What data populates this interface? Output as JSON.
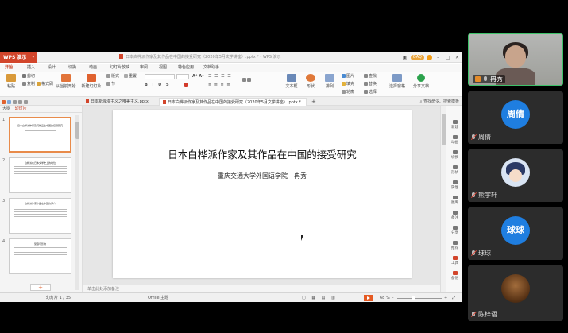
{
  "wps": {
    "app_label": "WPS 演示",
    "window_title": "日本白桦派作家及其作品在中国的接受研究（2020年5月文学讲座）.pptx * - WPS 演示",
    "user_label": "QAQ",
    "menus": [
      "开始",
      "插入",
      "设计",
      "切换",
      "动画",
      "幻灯片放映",
      "审阅",
      "视图",
      "特色应用",
      "文档助手"
    ],
    "ribbon": {
      "paste": "粘贴",
      "cut": "剪切",
      "copy": "复制",
      "format_painter": "格式刷",
      "from_start": "从当前开始",
      "new_slide": "新建幻灯片",
      "layout": "版式",
      "section": "节",
      "reset": "重置",
      "text_box": "文本框",
      "shapes": "形状",
      "arrange": "排列",
      "picture": "图片",
      "fill": "填充",
      "find": "查找",
      "replace": "替换",
      "select": "选择",
      "outline": "轮廓",
      "selection_pane": "选择窗格",
      "share_doc": "分享文档"
    },
    "tabs": [
      "日本新浪漫主义之唯美主义.pptx",
      "日本白桦派作家及其作品在中国的接受研究（2020年5月文学讲座）.pptx *"
    ],
    "search": "查找命令、搜索模板",
    "left_panel": {
      "tab_outline": "大纲",
      "tab_slides": "幻灯片",
      "thumbs": [
        {
          "num": "1",
          "title": "日本白桦派作家及其作品在中国的接受研究"
        },
        {
          "num": "2",
          "title": "白桦派在日本文学史上的地位"
        },
        {
          "num": "3",
          "title": "白桦派作家作品在中国的译介"
        },
        {
          "num": "4",
          "title": "受容与影响"
        }
      ]
    },
    "slide": {
      "title": "日本白桦派作家及其作品在中国的接受研究",
      "subtitle": "重庆交通大学外国语学院　冉秀"
    },
    "notes_placeholder": "单击此处添加备注",
    "side_tools": [
      "新建",
      "动画",
      "切换",
      "形状",
      "属性",
      "图库",
      "备注",
      "分享",
      "推荐",
      "工具",
      "备份"
    ],
    "status": {
      "slide_count": "幻灯片 1 / 35",
      "theme": "Office 主题",
      "zoom": "68 %"
    }
  },
  "participants": [
    {
      "name": "冉秀",
      "kind": "video",
      "mic": "on"
    },
    {
      "name": "周倩",
      "kind": "initials",
      "initials": "周倩",
      "mic": "off"
    },
    {
      "name": "熊宇轩",
      "kind": "anime",
      "mic": "off"
    },
    {
      "name": "球球",
      "kind": "initials",
      "initials": "球球",
      "mic": "off"
    },
    {
      "name": "陈梓语",
      "kind": "photo",
      "mic": "off"
    }
  ],
  "colors": {
    "wps_red": "#d2452b",
    "avatar_blue": "#1f7ee0",
    "active_green": "#3ec26a"
  }
}
